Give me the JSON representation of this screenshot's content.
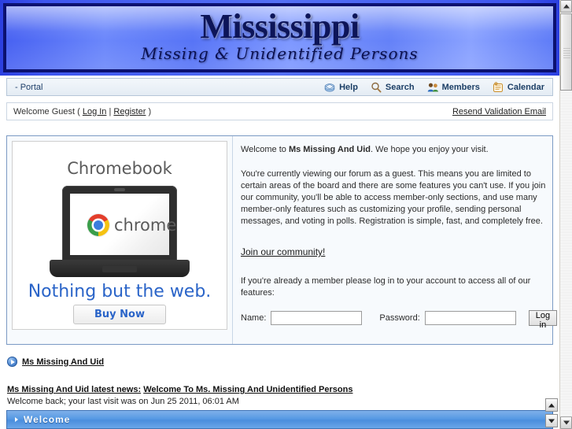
{
  "banner": {
    "title": "Mississippi",
    "subtitle": "Missing & Unidentified Persons"
  },
  "navbar": {
    "portal": "- Portal",
    "items": [
      {
        "label": "Help",
        "icon": "help-icon"
      },
      {
        "label": "Search",
        "icon": "search-icon"
      },
      {
        "label": "Members",
        "icon": "members-icon"
      },
      {
        "label": "Calendar",
        "icon": "calendar-icon"
      }
    ]
  },
  "welcome_strip": {
    "greeting_prefix": "Welcome Guest (",
    "login_label": "Log In",
    "separator": "|",
    "register_label": "Register",
    "greeting_suffix": ")",
    "resend_label": "Resend Validation Email"
  },
  "advert": {
    "title": "Chromebook",
    "brand_word": "chrome",
    "tagline": "Nothing but the web.",
    "button_label": "Buy Now"
  },
  "guest_panel": {
    "welcome_prefix": "Welcome to ",
    "site_name": "Ms Missing And Uid",
    "welcome_suffix": ". We hope you enjoy your visit.",
    "guest_paragraph": "You're currently viewing our forum as a guest. This means you are limited to certain areas of the board and there are some features you can't use. If you join our community, you'll be able to access member-only sections, and use many member-only features such as customizing your profile, sending personal messages, and voting in polls. Registration is simple, fast, and completely free.",
    "join_link": "Join our community!",
    "member_paragraph": "If you're already a member please log in to your account to access all of our features:",
    "name_label": "Name:",
    "name_value": "",
    "password_label": "Password:",
    "password_value": "",
    "login_button": "Log in"
  },
  "breadcrumb": {
    "label": "Ms Missing And Uid"
  },
  "news": {
    "label": "Ms Missing And Uid latest news:",
    "link": "Welcome To Ms. Missing And Unidentified Persons",
    "last_visit": "Welcome back; your last visit was on Jun 25 2011, 06:01 AM"
  },
  "category": {
    "title": "Welcome"
  },
  "colors": {
    "banner_blue": "#5774f6",
    "banner_border": "#0b1170",
    "accent_link": "#2a64c8",
    "category_bar": "#579ae4"
  }
}
